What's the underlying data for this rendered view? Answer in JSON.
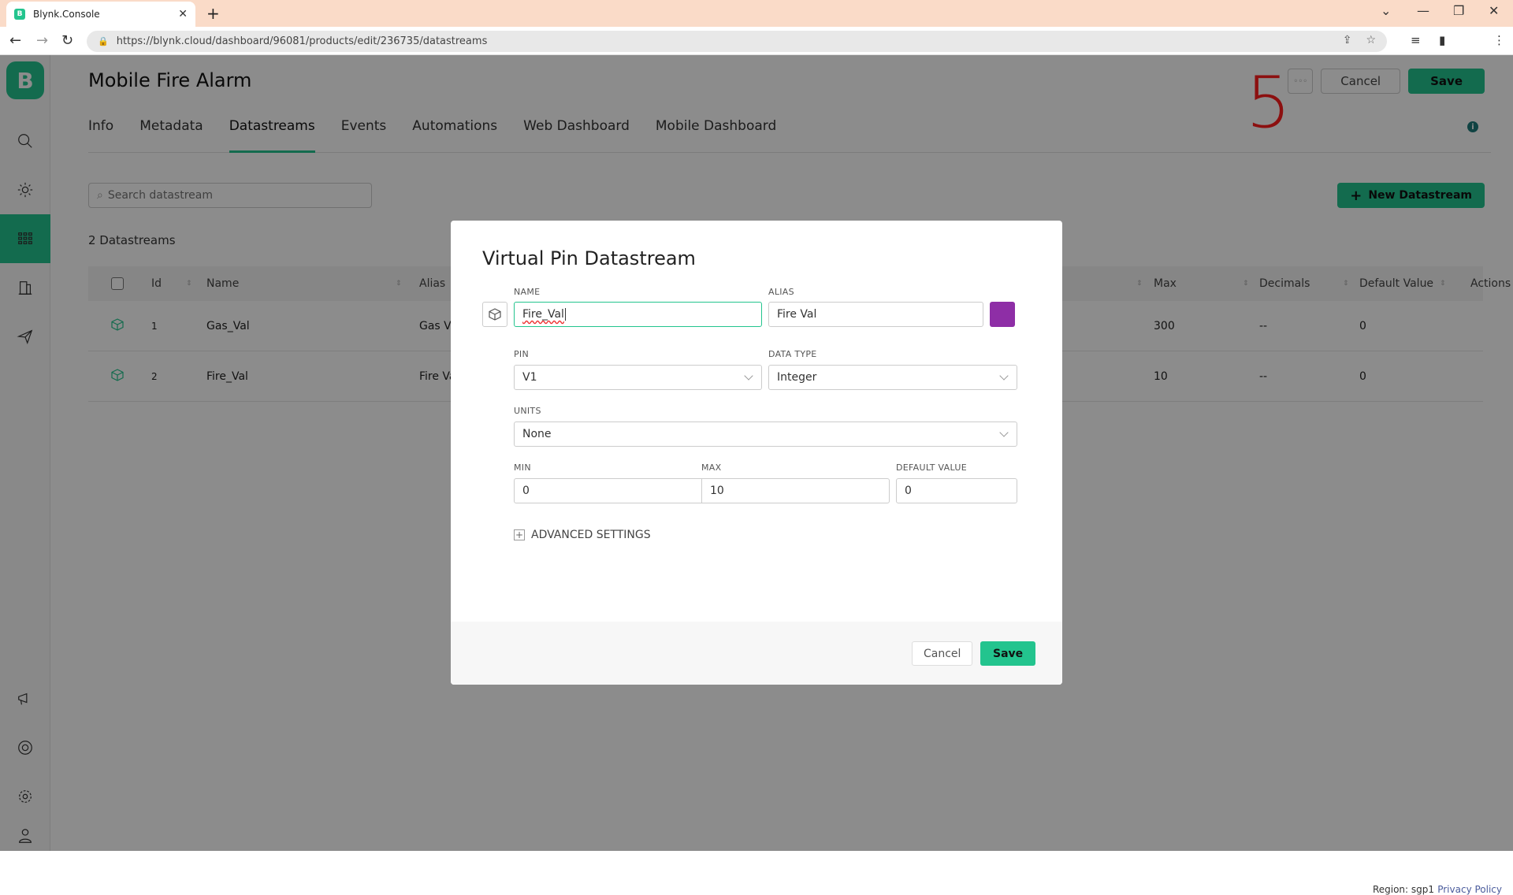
{
  "browser": {
    "tab_title": "Blynk.Console",
    "tab_favicon": "B",
    "url": "https://blynk.cloud/dashboard/96081/products/edit/236735/datastreams"
  },
  "sidebar": {
    "logo": "B",
    "items": [
      {
        "name": "search",
        "icon": "search-icon"
      },
      {
        "name": "developer-zone",
        "icon": "sun-icon"
      },
      {
        "name": "devices",
        "icon": "grid-icon",
        "active": true
      },
      {
        "name": "organizations",
        "icon": "building-icon"
      },
      {
        "name": "location",
        "icon": "paper-plane-icon"
      },
      {
        "name": "announcements",
        "icon": "megaphone-icon"
      },
      {
        "name": "help",
        "icon": "lifebuoy-icon"
      },
      {
        "name": "settings",
        "icon": "gear-icon"
      },
      {
        "name": "profile",
        "icon": "user-icon"
      }
    ]
  },
  "header": {
    "title": "Mobile Fire Alarm",
    "more_label": "◦◦◦",
    "cancel_label": "Cancel",
    "save_label": "Save",
    "step_annotation": "5",
    "tabs": [
      {
        "label": "Info"
      },
      {
        "label": "Metadata"
      },
      {
        "label": "Datastreams",
        "active": true
      },
      {
        "label": "Events"
      },
      {
        "label": "Automations"
      },
      {
        "label": "Web Dashboard"
      },
      {
        "label": "Mobile Dashboard"
      }
    ]
  },
  "datastreams": {
    "search_placeholder": "Search datastream",
    "new_button_label": "New Datastream",
    "count_label": "2 Datastreams",
    "columns": [
      "Id",
      "Name",
      "Alias",
      "Max",
      "Decimals",
      "Default Value",
      "Actions"
    ],
    "rows": [
      {
        "id": "1",
        "name": "Gas_Val",
        "alias": "Gas Va",
        "max": "300",
        "decimals": "--",
        "default": "0"
      },
      {
        "id": "2",
        "name": "Fire_Val",
        "alias": "Fire Va",
        "max": "10",
        "decimals": "--",
        "default": "0"
      }
    ]
  },
  "modal": {
    "title": "Virtual Pin Datastream",
    "name_label": "NAME",
    "name_value": "Fire_Val",
    "alias_label": "ALIAS",
    "alias_value": "Fire Val",
    "color": "#8e2ea6",
    "pin_label": "PIN",
    "pin_value": "V1",
    "data_type_label": "DATA TYPE",
    "data_type_value": "Integer",
    "units_label": "UNITS",
    "units_value": "None",
    "min_label": "MIN",
    "min_value": "0",
    "max_label": "MAX",
    "max_value": "10",
    "default_label": "DEFAULT VALUE",
    "default_value": "0",
    "advanced_label": "ADVANCED SETTINGS",
    "cancel_label": "Cancel",
    "save_label": "Save"
  },
  "footer": {
    "region": "Region: sgp1",
    "privacy": "Privacy Policy"
  },
  "colors": {
    "accent": "#23c48e",
    "annotation": "#ff1e1e"
  }
}
